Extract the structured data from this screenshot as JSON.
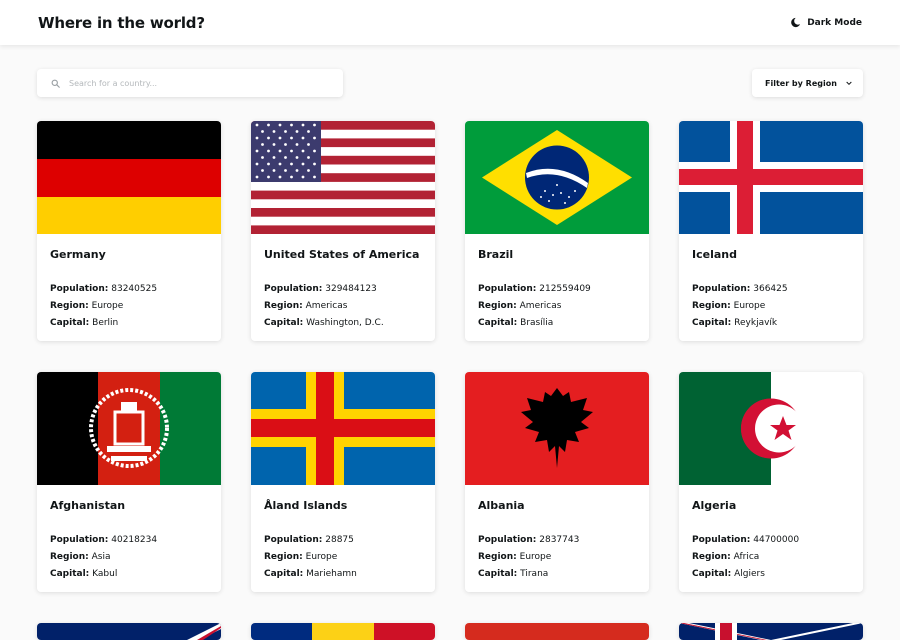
{
  "header": {
    "title": "Where in the world?",
    "dark_mode_label": "Dark Mode"
  },
  "search": {
    "placeholder": "Search for a country...",
    "value": ""
  },
  "filter": {
    "label": "Filter by Region"
  },
  "labels": {
    "population": "Population:",
    "region": "Region:",
    "capital": "Capital:"
  },
  "countries": [
    {
      "name": "Germany",
      "population": "83240525",
      "region": "Europe",
      "capital": "Berlin"
    },
    {
      "name": "United States of America",
      "population": "329484123",
      "region": "Americas",
      "capital": "Washington, D.C."
    },
    {
      "name": "Brazil",
      "population": "212559409",
      "region": "Americas",
      "capital": "Brasília"
    },
    {
      "name": "Iceland",
      "population": "366425",
      "region": "Europe",
      "capital": "Reykjavík"
    },
    {
      "name": "Afghanistan",
      "population": "40218234",
      "region": "Asia",
      "capital": "Kabul"
    },
    {
      "name": "Åland Islands",
      "population": "28875",
      "region": "Europe",
      "capital": "Mariehamn"
    },
    {
      "name": "Albania",
      "population": "2837743",
      "region": "Europe",
      "capital": "Tirana"
    },
    {
      "name": "Algeria",
      "population": "44700000",
      "region": "Africa",
      "capital": "Algiers"
    }
  ],
  "colors": {
    "background": "#fafafa",
    "card": "#ffffff",
    "text": "#111517"
  }
}
